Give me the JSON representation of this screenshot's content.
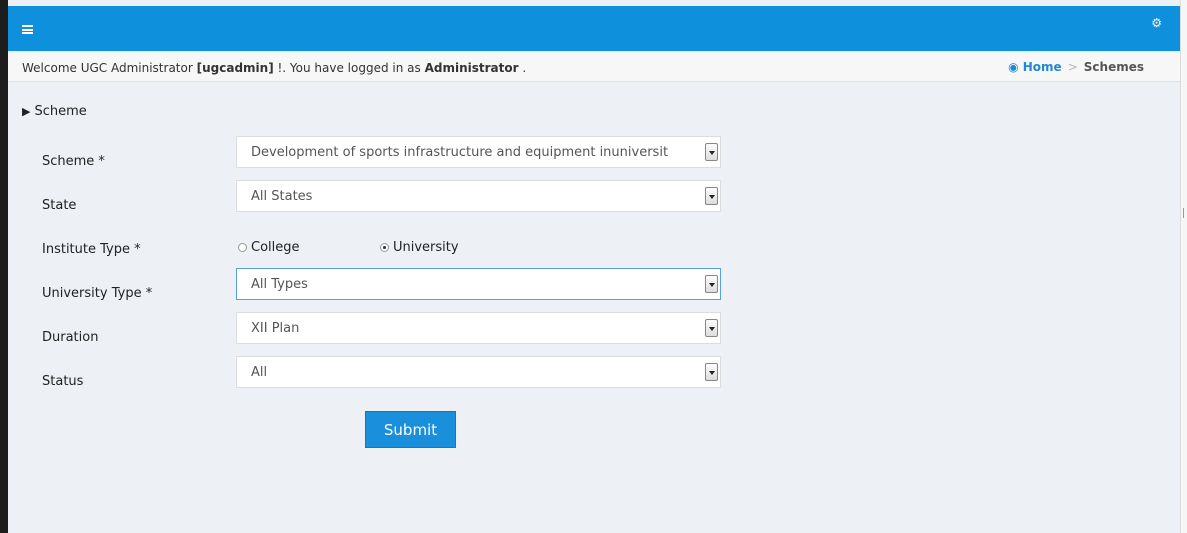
{
  "header": {
    "menu_icon": "hamburger-icon",
    "settings_icon": "gears-icon"
  },
  "welcome": {
    "prefix": "Welcome UGC Administrator ",
    "username": "[ugcadmin]",
    "middle": " !. You have logged in as ",
    "role": "Administrator",
    "suffix": " ."
  },
  "breadcrumb": {
    "home_icon": "dashboard-icon",
    "home": "Home",
    "separator": ">",
    "current": "Schemes"
  },
  "section": {
    "title": "Scheme"
  },
  "form": {
    "scheme": {
      "label": "Scheme *",
      "value": "Development of sports infrastructure and equipment inuniversit"
    },
    "state": {
      "label": "State",
      "value": "All States"
    },
    "institute_type": {
      "label": "Institute Type *",
      "options": [
        {
          "label": "College",
          "checked": false
        },
        {
          "label": "University",
          "checked": true
        }
      ]
    },
    "university_type": {
      "label": "University Type *",
      "value": "All Types"
    },
    "duration": {
      "label": "Duration",
      "value": "XII Plan"
    },
    "status": {
      "label": "Status",
      "value": "All"
    },
    "submit": "Submit"
  },
  "colors": {
    "topbar": "#0e90dd",
    "link": "#1e88d5",
    "button": "#1a8fdb",
    "background": "#edf0f5"
  }
}
